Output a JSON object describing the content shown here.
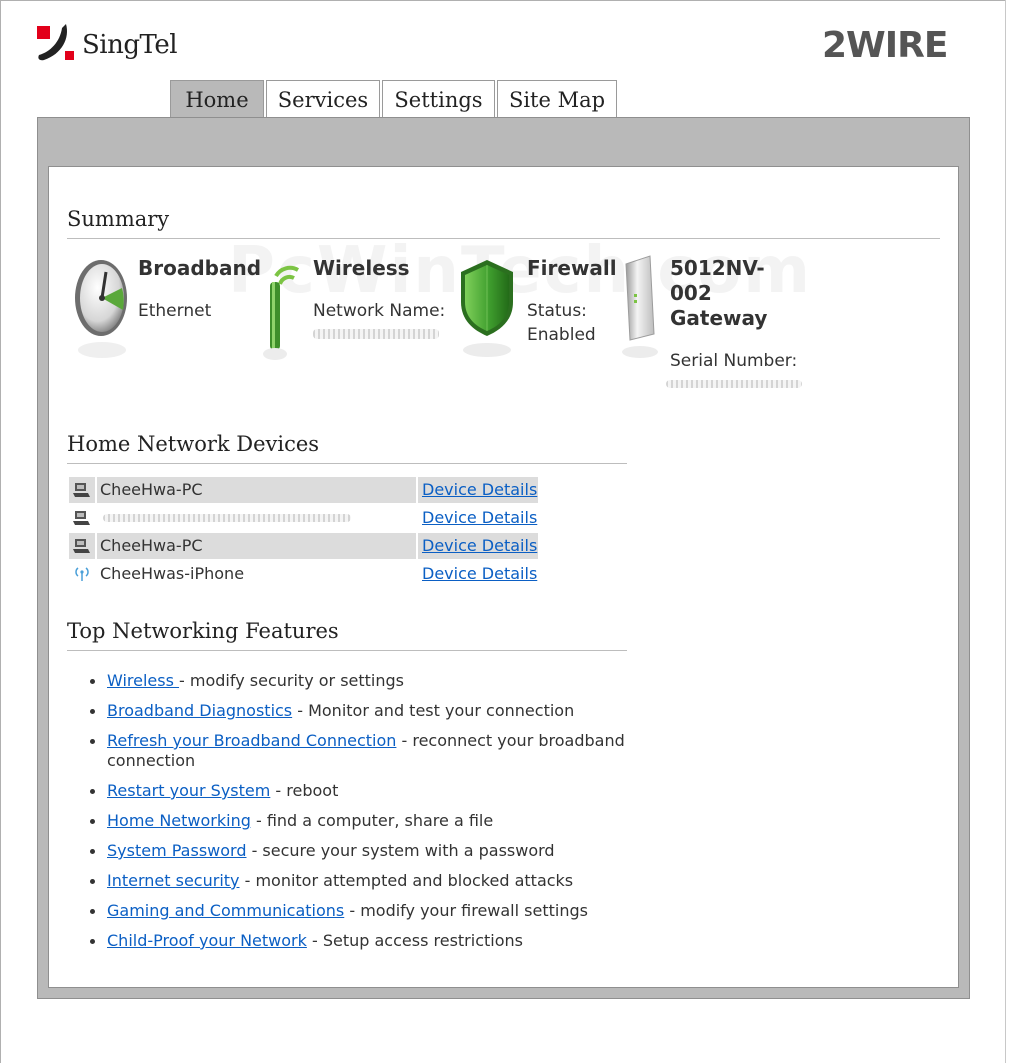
{
  "brand": {
    "left_logo": "SingTel",
    "right_logo": "2WIRE"
  },
  "tabs": [
    {
      "label": "Home",
      "active": true
    },
    {
      "label": "Services",
      "active": false
    },
    {
      "label": "Settings",
      "active": false
    },
    {
      "label": "Site Map",
      "active": false
    }
  ],
  "watermark": "PcWinTech.com",
  "summary": {
    "title": "Summary",
    "broadband": {
      "heading": "Broadband",
      "detail": "Ethernet"
    },
    "wireless": {
      "heading": "Wireless",
      "detail": "Network Name:"
    },
    "firewall": {
      "heading": "Firewall",
      "status_label": "Status:",
      "status_value": "Enabled"
    },
    "gateway": {
      "heading": "5012NV-002 Gateway",
      "serial_label": "Serial Number:"
    }
  },
  "devices": {
    "title": "Home Network Devices",
    "link_label": "Device Details",
    "rows": [
      {
        "name": "CheeHwa-PC",
        "icon": "computer-icon"
      },
      {
        "name": "",
        "icon": "computer-icon"
      },
      {
        "name": "CheeHwa-PC",
        "icon": "computer-icon"
      },
      {
        "name": "CheeHwas-iPhone",
        "icon": "wireless-device-icon"
      }
    ]
  },
  "features": {
    "title": "Top Networking Features",
    "items": [
      {
        "link": "Wireless ",
        "desc": " - modify security or settings"
      },
      {
        "link": "Broadband Diagnostics",
        "desc": " - Monitor and test your connection"
      },
      {
        "link": "Refresh your Broadband Connection",
        "desc": " - reconnect your broadband connection"
      },
      {
        "link": "Restart your System",
        "desc": " - reboot"
      },
      {
        "link": "Home Networking",
        "desc": " - find a computer, share a file"
      },
      {
        "link": "System Password",
        "desc": " - secure your system with a password"
      },
      {
        "link": "Internet security",
        "desc": " - monitor attempted and blocked attacks"
      },
      {
        "link": "Gaming and Communications",
        "desc": " - modify your firewall settings"
      },
      {
        "link": "Child-Proof your Network",
        "desc": " - Setup access restrictions"
      }
    ]
  },
  "colors": {
    "link": "#0b5fc4",
    "panel": "#b9b9b9",
    "row_shade": "#dcdcdc",
    "firewall_green": "#3f9e2e",
    "brand_red": "#e2001a"
  }
}
